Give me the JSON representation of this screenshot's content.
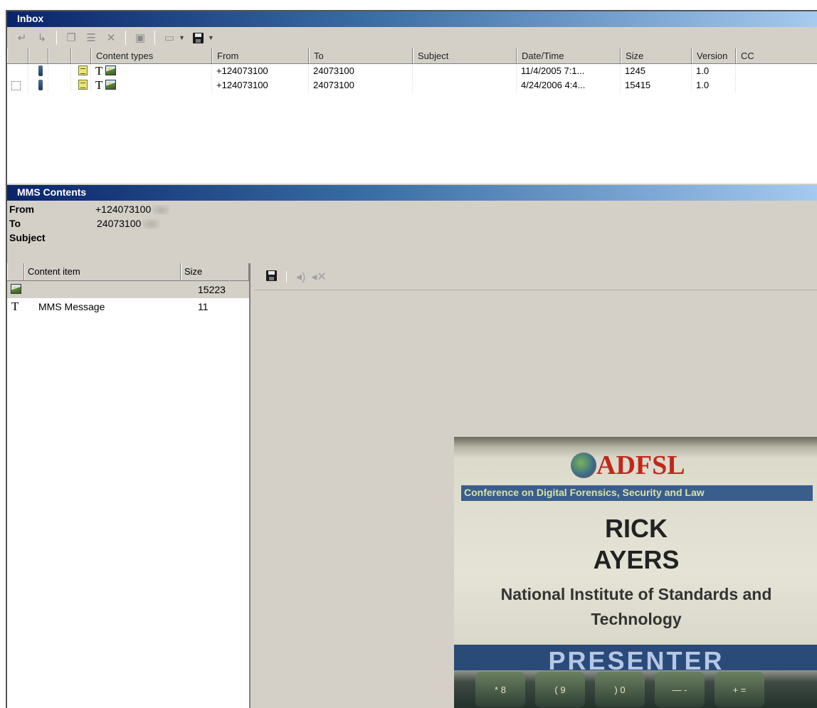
{
  "inbox": {
    "title": "Inbox",
    "toolbar_icons": [
      "reply-icon",
      "forward-icon",
      "copy-icon",
      "properties-icon",
      "delete-icon",
      "export-icon",
      "open-folder-icon",
      "save-icon"
    ],
    "columns": [
      "Content types",
      "From",
      "To",
      "Subject",
      "Date/Time",
      "Size",
      "Version",
      "CC"
    ],
    "rows": [
      {
        "from": "+124073100",
        "to": "24073100",
        "subject": "",
        "datetime": "11/4/2005 7:1...",
        "size": "1245",
        "version": "1.0",
        "cc": "",
        "content_types": [
          "T",
          "image"
        ]
      },
      {
        "from": "+124073100",
        "to": "24073100",
        "subject": "",
        "datetime": "4/24/2006 4:4...",
        "size": "15415",
        "version": "1.0",
        "cc": "",
        "content_types": [
          "T",
          "image"
        ]
      }
    ]
  },
  "mms": {
    "title": "MMS Contents",
    "from_label": "From",
    "from_value": "+124073100",
    "to_label": "To",
    "to_value": "24073100",
    "subject_label": "Subject",
    "subject_value": "",
    "items_columns": [
      "Content item",
      "Size"
    ],
    "items": [
      {
        "icon": "image-icon",
        "name": "",
        "size": "15223"
      },
      {
        "icon": "text-icon",
        "type_glyph": "T",
        "name": "MMS Message",
        "size": "11"
      }
    ],
    "viewer_toolbar_icons": [
      "save-icon",
      "speaker-icon",
      "mute-icon"
    ]
  },
  "photo": {
    "logo": "ADFSL",
    "banner": "Conference on Digital Forensics, Security and Law",
    "name_line1": "RICK",
    "name_line2": "AYERS",
    "org_line1": "National Institute of Standards and",
    "org_line2": "Technology",
    "role": "PRESENTER",
    "keys": [
      "* 8",
      "( 9",
      ") 0",
      "— -",
      "+ ="
    ]
  },
  "colors": {
    "titlebar_start": "#0a246a",
    "titlebar_end": "#a6caf0",
    "window_bg": "#d4d0c8",
    "logo_red": "#c0281a"
  }
}
